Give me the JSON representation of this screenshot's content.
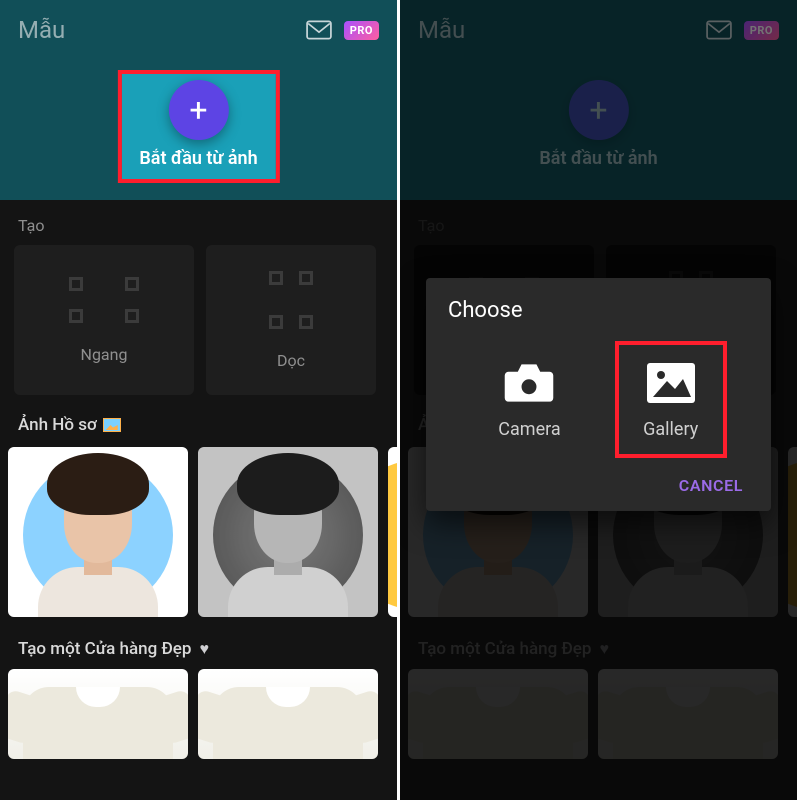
{
  "header": {
    "title": "Mẫu",
    "pro_badge": "PRO"
  },
  "start": {
    "label": "Bắt đầu từ ảnh"
  },
  "create": {
    "section_label": "Tạo",
    "cards": [
      {
        "label": "Ngang"
      },
      {
        "label": "Dọc"
      }
    ]
  },
  "profile": {
    "section_label": "Ảnh Hồ sơ"
  },
  "store": {
    "section_label": "Tạo một Cửa hàng Đẹp"
  },
  "dialog": {
    "title": "Choose",
    "camera_label": "Camera",
    "gallery_label": "Gallery",
    "cancel_label": "CANCEL"
  }
}
